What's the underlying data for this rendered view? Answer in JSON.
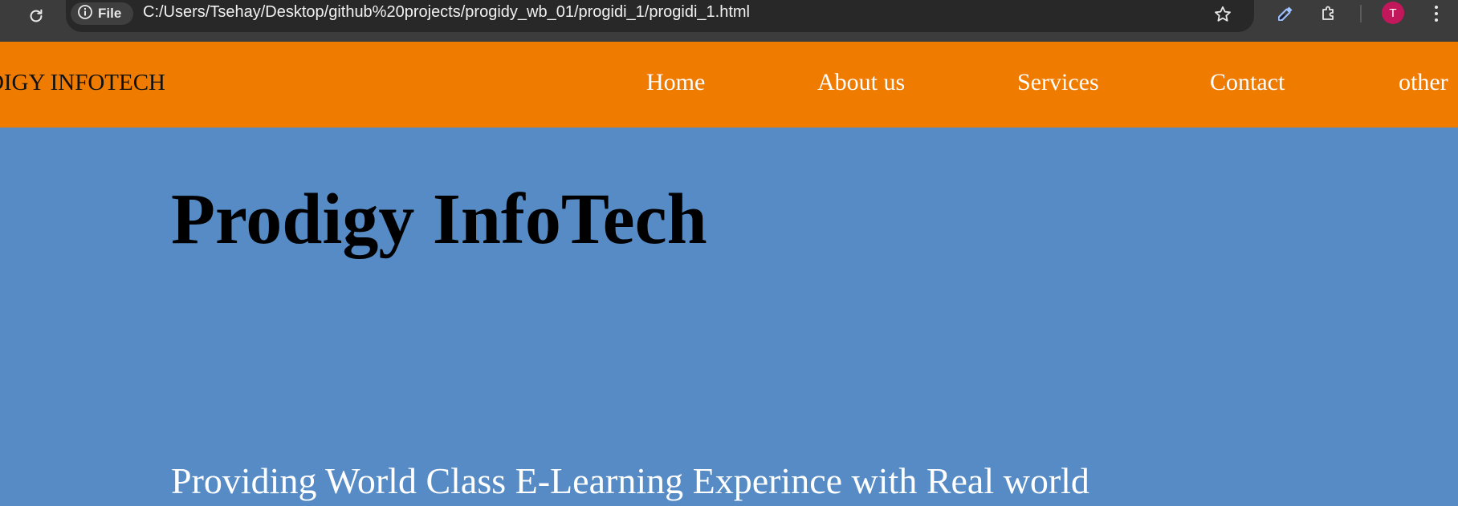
{
  "browser": {
    "site_chip_label": "File",
    "url": "C:/Users/Tsehay/Desktop/github%20projects/progidy_wb_01/progidi_1/progidi_1.html",
    "profile_initial": "T",
    "profile_color": "#c2185b",
    "icons": [
      "reload-icon",
      "info-icon",
      "bookmark-star-icon",
      "eyedropper-icon",
      "extensions-puzzle-icon",
      "menu-kebab-icon"
    ]
  },
  "navbar": {
    "brand": "ODIGY INFOTECH",
    "links": [
      "Home",
      "About us",
      "Services",
      "Contact",
      "other"
    ],
    "background": "#ef7b00"
  },
  "hero": {
    "title": "Prodigy InfoTech",
    "subtitle": "Providing World Class E-Learning Experince with Real world",
    "background": "#568bc5"
  }
}
